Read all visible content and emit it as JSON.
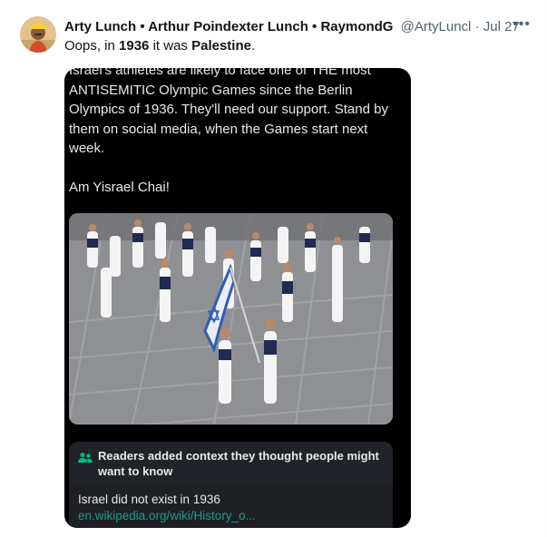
{
  "tweet": {
    "display_name": "Arty Lunch • Arthur Poindexter Lunch • RaymondG",
    "handle": "@ArtyLuncl",
    "separator": "·",
    "date": "Jul 27",
    "more_icon": "ellipsis-icon",
    "text_parts": [
      "Oops, in ",
      "1936",
      " it was ",
      "Palestine",
      "."
    ]
  },
  "quoted": {
    "paragraph_1": "Israel's athletes are likely to face one of THE most ANTISEMITIC Olympic Games since the Berlin Olympics of 1936. They'll need our support. Stand by them on social media, when the Games start next week.",
    "paragraph_2": "Am Yisrael Chai!",
    "image_icon": "olympic-parade-photo"
  },
  "community_note": {
    "icon": "people-icon",
    "title": "Readers added context they thought people might want to know",
    "body_text": "Israel did not exist in 1936 ",
    "link_text": "en.wikipedia.org/wiki/History_o...",
    "accent_color": "#1d9b8a"
  },
  "colors": {
    "card_background": "#000000",
    "secondary_text": "#536471"
  }
}
